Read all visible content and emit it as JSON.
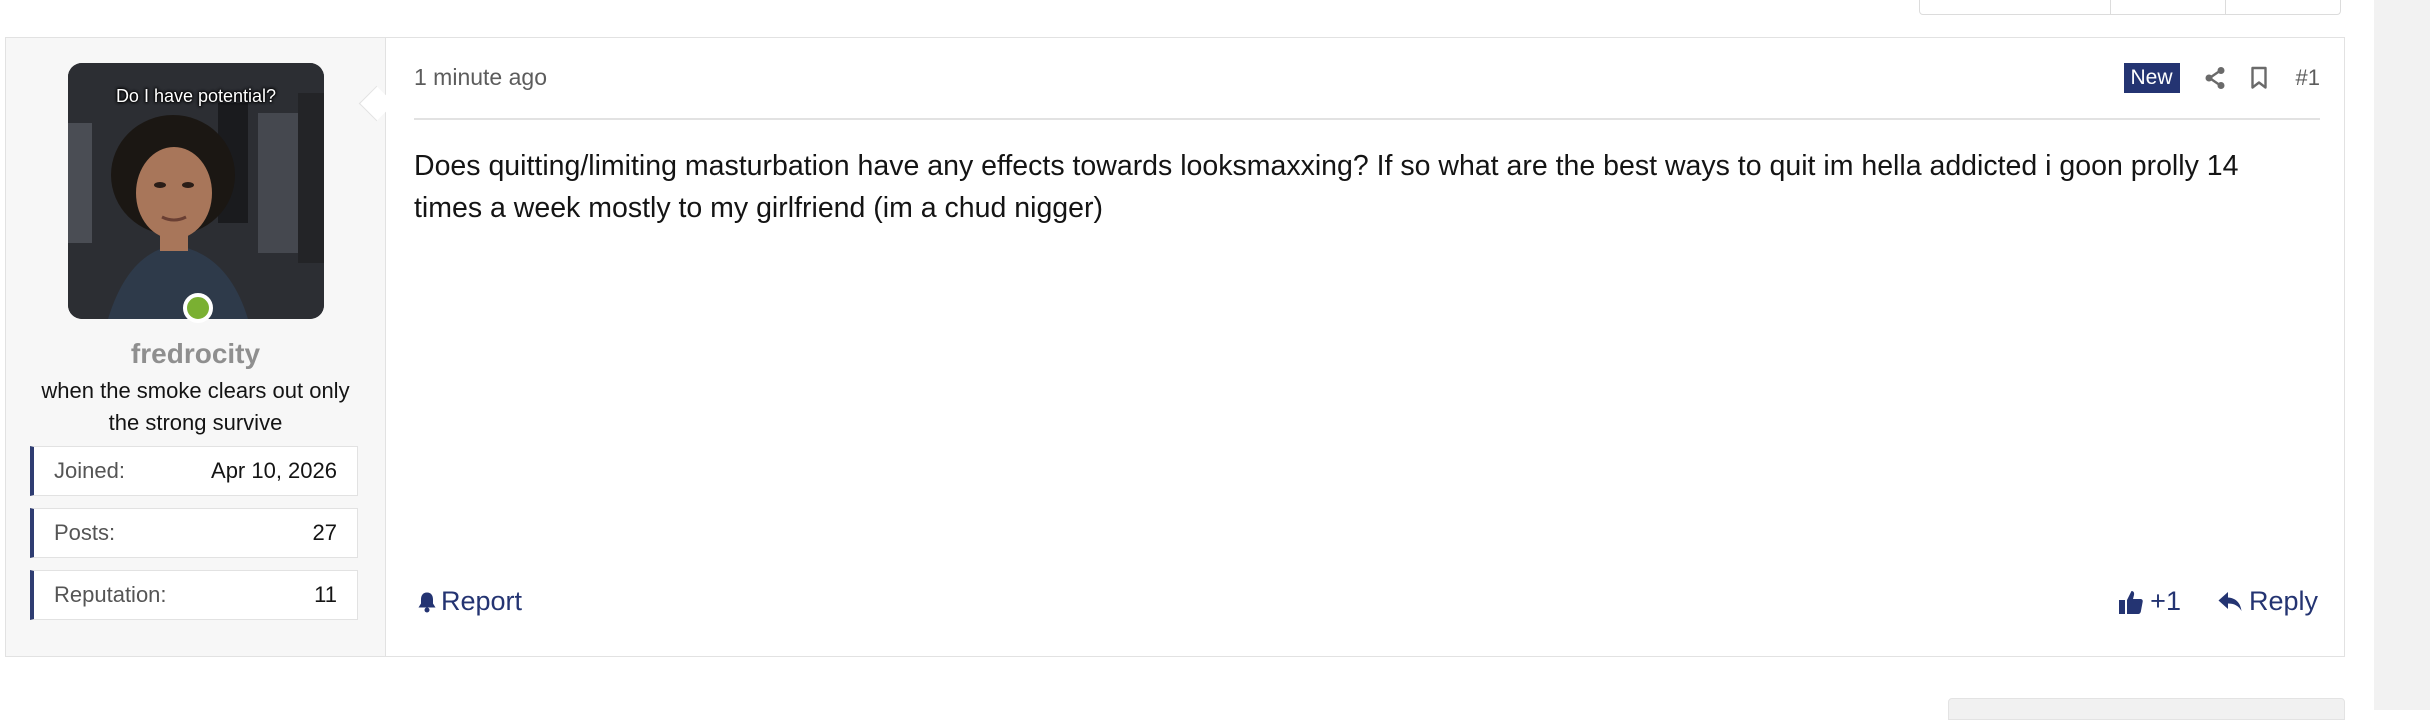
{
  "post": {
    "avatar_caption": "Do I have potential?",
    "username": "fredrocity",
    "user_title": "when the smoke clears out only the strong survive",
    "stats": [
      {
        "label": "Joined:",
        "value": "Apr 10, 2026"
      },
      {
        "label": "Posts:",
        "value": "27"
      },
      {
        "label": "Reputation:",
        "value": "11"
      }
    ],
    "time": "1 minute ago",
    "badge": "New",
    "post_number": "#1",
    "content": "Does quitting/limiting masturbation have any effects towards looksmaxxing? If so what are the best ways to quit im hella addicted i goon prolly 14 times a week mostly to my girlfriend (im a chud nigger)",
    "report_label": "Report",
    "reaction_count": "+1",
    "reply_label": "Reply",
    "icons": {
      "share": "share-icon",
      "bookmark": "bookmark-icon",
      "report": "bell-icon",
      "reaction": "thumbs-up-icon",
      "reply": "reply-arrow-icon"
    },
    "colors": {
      "accent": "#243472",
      "online": "#7ab032",
      "username": "#8f8f8f"
    }
  }
}
